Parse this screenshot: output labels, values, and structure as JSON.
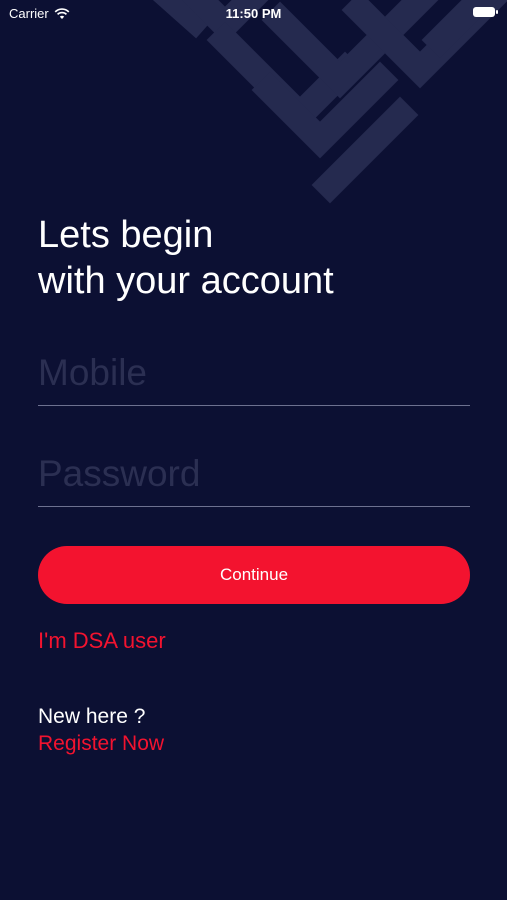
{
  "status_bar": {
    "carrier": "Carrier",
    "time": "11:50 PM"
  },
  "login": {
    "heading_line1": "Lets begin",
    "heading_line2": "with your account",
    "mobile_placeholder": "Mobile",
    "mobile_value": "",
    "password_placeholder": "Password",
    "password_value": "",
    "continue_label": "Continue",
    "dsa_link": "I'm DSA user",
    "new_here": "New here ?",
    "register_link": "Register Now"
  },
  "colors": {
    "background": "#0c1033",
    "accent": "#f3132f",
    "decor": "#252a4f"
  }
}
